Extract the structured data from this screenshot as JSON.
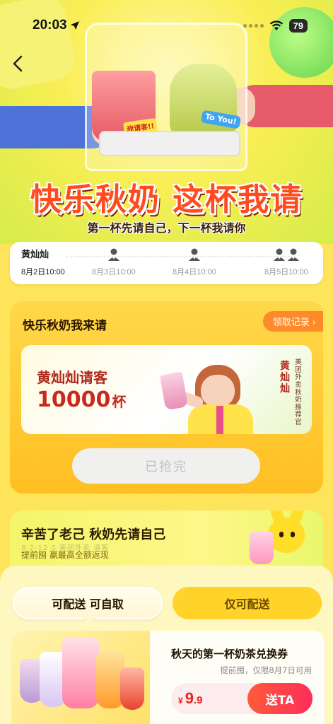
{
  "status_bar": {
    "time": "20:03",
    "battery": "79"
  },
  "hero": {
    "cup1_tag": "我请客!!",
    "cup2_tag": "To You!",
    "title": "快乐秋奶 这杯我请",
    "subtitle": "第一杯先请自己，下一杯我请你"
  },
  "timeline": {
    "nodes": [
      {
        "name": "黄灿灿",
        "date": "8月2日10:00"
      },
      {
        "name": "",
        "date": "8月3日10:00"
      },
      {
        "name": "",
        "date": "8月4日10:00"
      },
      {
        "name": "",
        "date": "8月5日10:00"
      }
    ]
  },
  "main_card": {
    "title": "快乐秋奶我来请",
    "records_label": "领取记录 ›",
    "treat_label": "黄灿灿请客",
    "treat_count": "10000",
    "treat_unit": "杯",
    "star_name": "黄灿灿",
    "star_role": "美团外卖秋奶推荐官",
    "soldout_label": "已抢完"
  },
  "promo": {
    "title": "辛苦了老己 秋奶先请自己",
    "faded_text": "8.2-12.0 美团外卖 请客",
    "subtitle": "提前囤 赢最高全额返现"
  },
  "tabs": [
    {
      "label": "可配送 可自取",
      "active": true
    },
    {
      "label": "仅可配送",
      "active": false
    }
  ],
  "product": {
    "title": "秋天的第一杯奶茶兑换券",
    "desc": "提前囤，仅限8月7日可用",
    "currency": "¥",
    "price_int": "9",
    "price_dec": ".9",
    "send_label": "送TA"
  },
  "colors": {
    "accent_orange": "#ff4b1f",
    "brand_yellow": "#ffd32a",
    "price_red": "#e8221c",
    "button_pink": "#ff2d5a"
  }
}
